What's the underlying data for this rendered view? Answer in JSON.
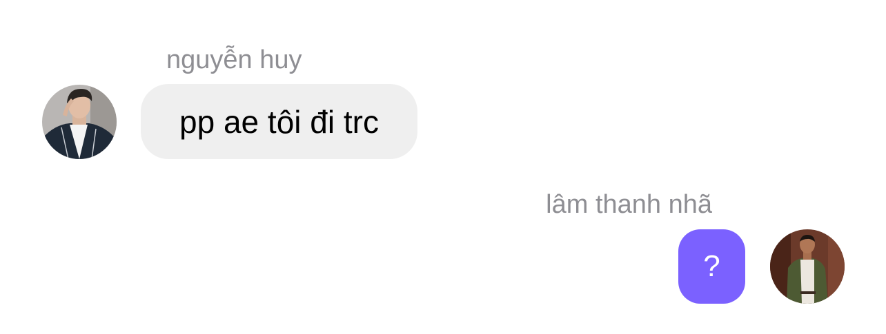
{
  "chat": {
    "messages": [
      {
        "sender": "nguyễn huy",
        "text": "pp ae tôi đi trc",
        "direction": "incoming",
        "avatar": "profile-photo"
      },
      {
        "sender": "lâm thanh nhã",
        "text": "?",
        "direction": "outgoing",
        "avatar": "profile-photo"
      }
    ]
  },
  "colors": {
    "incoming_bubble": "#efefef",
    "outgoing_bubble": "#7b61ff",
    "sender_name": "#8e8e93",
    "background": "#ffffff"
  }
}
